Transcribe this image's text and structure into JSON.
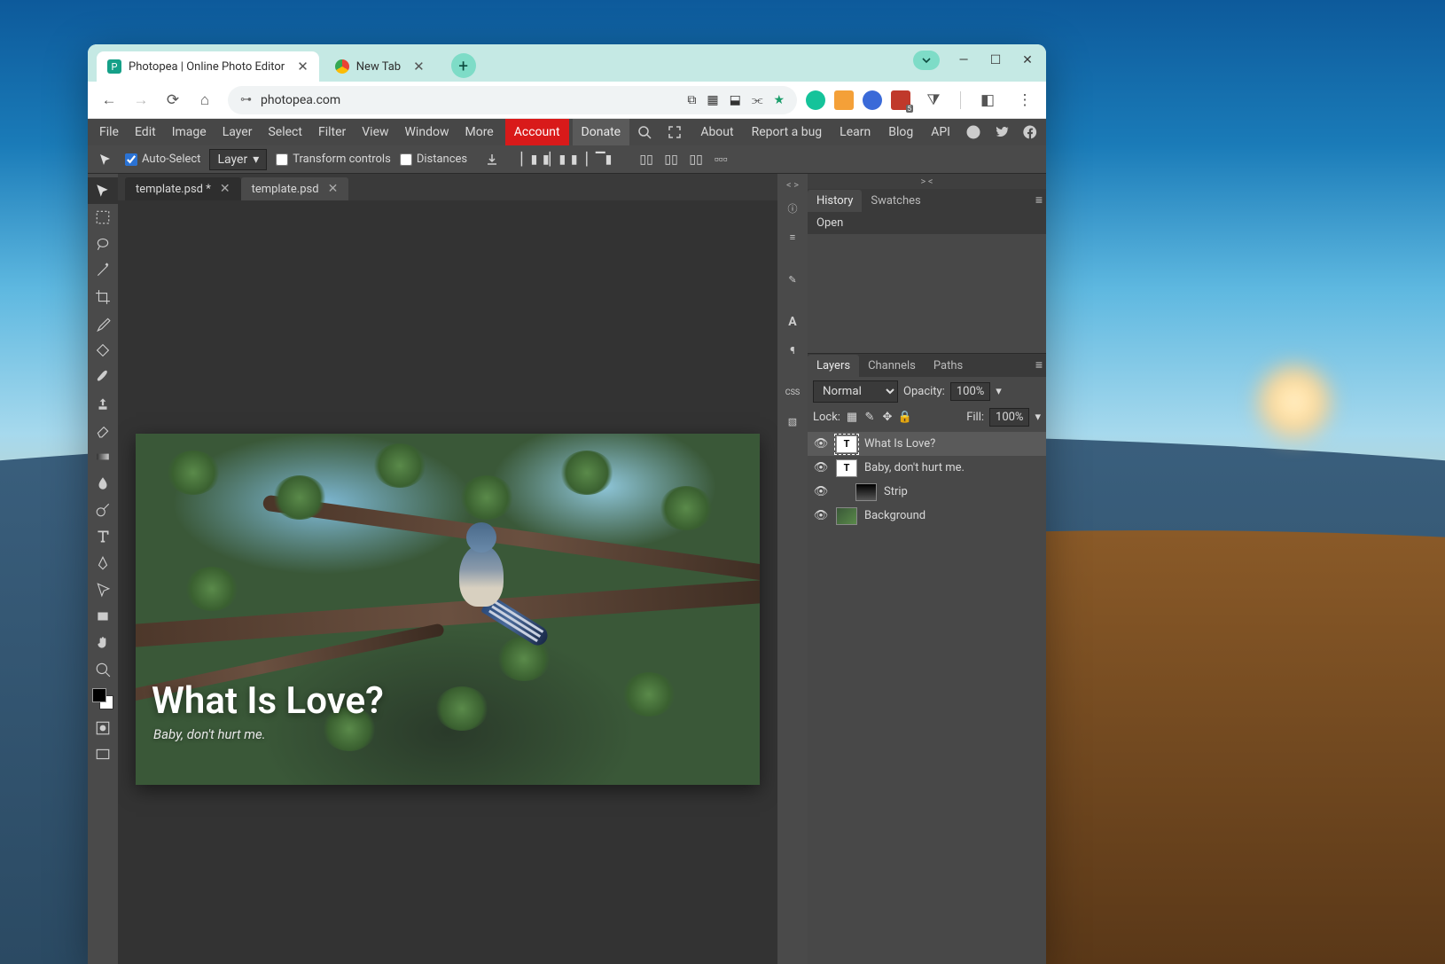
{
  "browser": {
    "tabs": [
      {
        "title": "Photopea | Online Photo Editor",
        "active": true
      },
      {
        "title": "New Tab",
        "active": false
      }
    ],
    "url": "photopea.com"
  },
  "menubar": {
    "items": [
      "File",
      "Edit",
      "Image",
      "Layer",
      "Select",
      "Filter",
      "View",
      "Window",
      "More"
    ],
    "account": "Account",
    "donate": "Donate",
    "right": [
      "About",
      "Report a bug",
      "Learn",
      "Blog",
      "API"
    ]
  },
  "optionsbar": {
    "auto_select": "Auto-Select",
    "target": "Layer",
    "transform": "Transform controls",
    "distances": "Distances"
  },
  "doc_tabs": [
    {
      "name": "template.psd *",
      "active": true
    },
    {
      "name": "template.psd",
      "active": false
    }
  ],
  "canvas": {
    "title": "What Is Love?",
    "subtitle": "Baby, don't hurt me."
  },
  "mid_handles": {
    "left": "< >",
    "right": "> <"
  },
  "panels": {
    "history": {
      "tabs": [
        "History",
        "Swatches"
      ],
      "active": 0,
      "items": [
        "Open"
      ]
    },
    "layers": {
      "tabs": [
        "Layers",
        "Channels",
        "Paths"
      ],
      "active": 0,
      "blend": "Normal",
      "opacity_label": "Opacity:",
      "opacity": "100%",
      "lock_label": "Lock:",
      "fill_label": "Fill:",
      "fill": "100%",
      "items": [
        {
          "name": "What Is Love?",
          "type": "T",
          "selected": true
        },
        {
          "name": "Baby, don't hurt me.",
          "type": "T",
          "selected": false
        },
        {
          "name": "Strip",
          "type": "grad",
          "selected": false
        },
        {
          "name": "Background",
          "type": "img",
          "selected": false
        }
      ]
    }
  }
}
